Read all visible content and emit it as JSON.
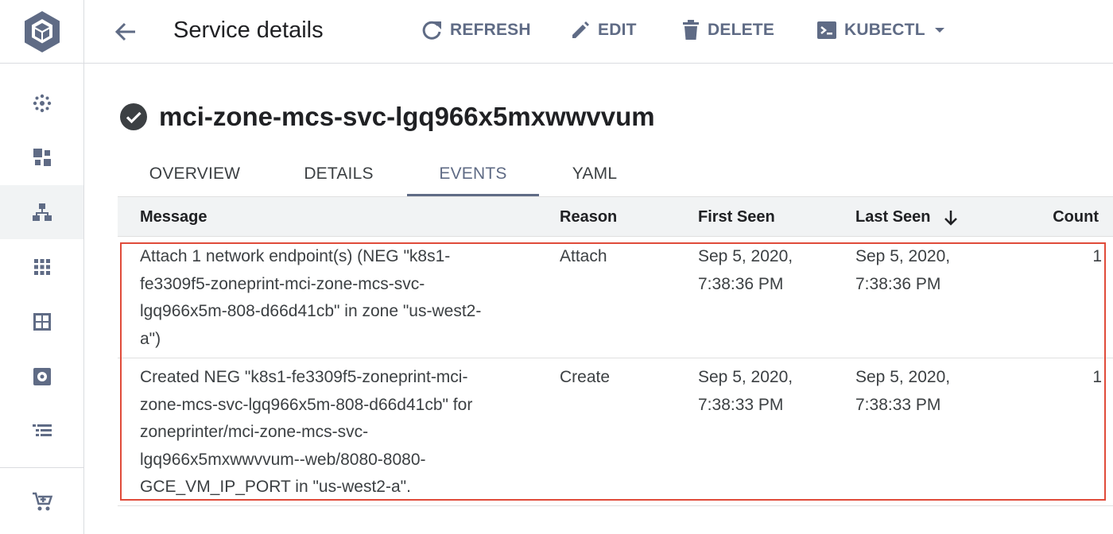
{
  "colors": {
    "accent": "#5f6b85",
    "highlight_border": "#e04b3a",
    "header_bg": "#f1f3f4",
    "text": "#202124"
  },
  "rail": {
    "logo_icon": "kubernetes-cube-logo-icon",
    "items": [
      {
        "icon": "clusters-icon",
        "active": false
      },
      {
        "icon": "workloads-icon",
        "active": false
      },
      {
        "icon": "services-icon",
        "active": true
      },
      {
        "icon": "applications-icon",
        "active": false
      },
      {
        "icon": "configuration-icon",
        "active": false
      },
      {
        "icon": "storage-icon",
        "active": false
      },
      {
        "icon": "object-browser-icon",
        "active": false
      },
      {
        "icon": "marketplace-icon",
        "active": false
      }
    ]
  },
  "header": {
    "back_icon": "arrow-back-icon",
    "title": "Service details",
    "actions": {
      "refresh": "REFRESH",
      "edit": "EDIT",
      "delete": "DELETE",
      "kubectl": "KUBECTL"
    }
  },
  "resource": {
    "status_icon": "check-circle-icon",
    "name": "mci-zone-mcs-svc-lgq966x5mxwwvvum"
  },
  "tabs": [
    {
      "label": "OVERVIEW",
      "active": false
    },
    {
      "label": "DETAILS",
      "active": false
    },
    {
      "label": "EVENTS",
      "active": true
    },
    {
      "label": "YAML",
      "active": false
    }
  ],
  "events_table": {
    "columns": {
      "message": "Message",
      "reason": "Reason",
      "first_seen": "First Seen",
      "last_seen": "Last Seen",
      "count": "Count"
    },
    "sorted_by": "Last Seen",
    "sort_direction": "descending",
    "rows": [
      {
        "message_lines": [
          "Attach 1 network endpoint(s) (NEG \"k8s1-",
          "fe3309f5-zoneprint-mci-zone-mcs-svc-",
          "lgq966x5m-808-d66d41cb\" in zone \"us-west2-",
          "a\")"
        ],
        "reason": "Attach",
        "first_seen_lines": [
          "Sep 5, 2020,",
          "7:38:36 PM"
        ],
        "last_seen_lines": [
          "Sep 5, 2020,",
          "7:38:36 PM"
        ],
        "count": "1"
      },
      {
        "message_lines": [
          "Created NEG \"k8s1-fe3309f5-zoneprint-mci-",
          "zone-mcs-svc-lgq966x5m-808-d66d41cb\" for",
          "zoneprinter/mci-zone-mcs-svc-",
          "lgq966x5mxwwvvum--web/8080-8080-",
          "GCE_VM_IP_PORT in \"us-west2-a\"."
        ],
        "reason": "Create",
        "first_seen_lines": [
          "Sep 5, 2020,",
          "7:38:33 PM"
        ],
        "last_seen_lines": [
          "Sep 5, 2020,",
          "7:38:33 PM"
        ],
        "count": "1"
      }
    ]
  }
}
